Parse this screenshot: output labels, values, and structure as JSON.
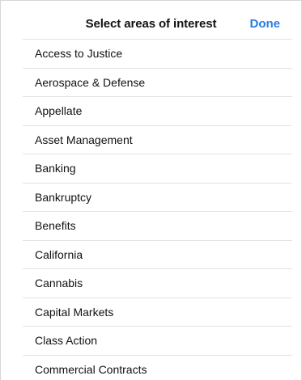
{
  "header": {
    "title": "Select areas of interest",
    "done_label": "Done"
  },
  "colors": {
    "accent": "#2a7ae2",
    "separator": "#e3e3e3",
    "text": "#111111"
  },
  "list": {
    "items": [
      {
        "label": "Access to Justice"
      },
      {
        "label": "Aerospace & Defense"
      },
      {
        "label": "Appellate"
      },
      {
        "label": "Asset Management"
      },
      {
        "label": "Banking"
      },
      {
        "label": "Bankruptcy"
      },
      {
        "label": "Benefits"
      },
      {
        "label": "California"
      },
      {
        "label": "Cannabis"
      },
      {
        "label": "Capital Markets"
      },
      {
        "label": "Class Action"
      },
      {
        "label": "Commercial Contracts"
      }
    ]
  }
}
